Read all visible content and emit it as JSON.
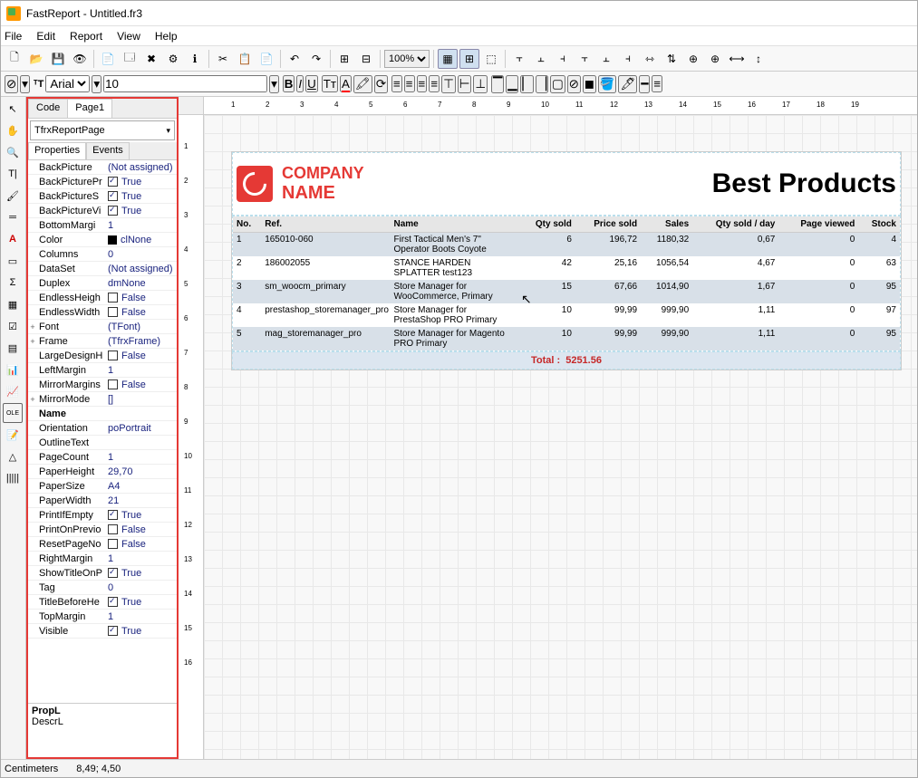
{
  "window": {
    "title": "FastReport - Untitled.fr3"
  },
  "menu": [
    "File",
    "Edit",
    "Report",
    "View",
    "Help"
  ],
  "toolbar": {
    "zoom": "100%",
    "font_label": "Arial",
    "font_size": "10"
  },
  "main_tabs": [
    "Code",
    "Page1"
  ],
  "combo": "TfrxReportPage",
  "sub_tabs": [
    "Properties",
    "Events"
  ],
  "props": [
    {
      "key": "BackPicture",
      "val": "(Not assigned)",
      "link": true
    },
    {
      "key": "BackPicturePrintable",
      "short": "BackPicturePr",
      "val": "True",
      "chk": true
    },
    {
      "key": "BackPictureStretched",
      "short": "BackPictureS",
      "val": "True",
      "chk": true
    },
    {
      "key": "BackPictureVisible",
      "short": "BackPictureVi",
      "val": "True",
      "chk": true
    },
    {
      "key": "BottomMargin",
      "short": "BottomMargi",
      "val": "1"
    },
    {
      "key": "Color",
      "val": "clNone",
      "swatch": true
    },
    {
      "key": "Columns",
      "val": "0"
    },
    {
      "key": "DataSet",
      "val": "(Not assigned)",
      "link": true
    },
    {
      "key": "Duplex",
      "val": "dmNone"
    },
    {
      "key": "EndlessHeight",
      "short": "EndlessHeigh",
      "val": "False",
      "chk": false
    },
    {
      "key": "EndlessWidth",
      "short": "EndlessWidth",
      "val": "False",
      "chk": false
    },
    {
      "key": "Font",
      "val": "(TFont)",
      "exp": "+",
      "link": true
    },
    {
      "key": "Frame",
      "val": "(TfrxFrame)",
      "exp": "+",
      "link": true
    },
    {
      "key": "LargeDesignHeight",
      "short": "LargeDesignH",
      "val": "False",
      "chk": false
    },
    {
      "key": "LeftMargin",
      "val": "1"
    },
    {
      "key": "MirrorMargins",
      "short": "MirrorMargins",
      "val": "False",
      "chk": false
    },
    {
      "key": "MirrorMode",
      "val": "[]",
      "exp": "+"
    },
    {
      "key": "Name",
      "val": "",
      "bold": true
    },
    {
      "key": "Orientation",
      "val": "poPortrait"
    },
    {
      "key": "OutlineText",
      "val": ""
    },
    {
      "key": "PageCount",
      "val": "1"
    },
    {
      "key": "PaperHeight",
      "val": "29,70"
    },
    {
      "key": "PaperSize",
      "val": "A4"
    },
    {
      "key": "PaperWidth",
      "val": "21"
    },
    {
      "key": "PrintIfEmpty",
      "val": "True",
      "chk": true
    },
    {
      "key": "PrintOnPreviousPage",
      "short": "PrintOnPrevio",
      "val": "False",
      "chk": false
    },
    {
      "key": "ResetPageNumbers",
      "short": "ResetPageNo",
      "val": "False",
      "chk": false
    },
    {
      "key": "RightMargin",
      "val": "1"
    },
    {
      "key": "ShowTitleOnPreviousPage",
      "short": "ShowTitleOnP",
      "val": "True",
      "chk": true
    },
    {
      "key": "Tag",
      "val": "0"
    },
    {
      "key": "TitleBeforeHeader",
      "short": "TitleBeforeHe",
      "val": "True",
      "chk": true
    },
    {
      "key": "TopMargin",
      "val": "1"
    },
    {
      "key": "Visible",
      "val": "True",
      "chk": true
    }
  ],
  "footer": {
    "prop": "PropL",
    "desc": "DescrL"
  },
  "ruler_h": [
    "1",
    "2",
    "3",
    "4",
    "5",
    "6",
    "7",
    "8",
    "9",
    "10",
    "11",
    "12",
    "13",
    "14",
    "15",
    "16",
    "17",
    "18",
    "19"
  ],
  "ruler_v": [
    "1",
    "2",
    "3",
    "4",
    "5",
    "6",
    "7",
    "8",
    "9",
    "10",
    "11",
    "12",
    "13",
    "14",
    "15",
    "16"
  ],
  "report": {
    "company_line1": "COMPANY",
    "company_line2": "NAME",
    "title": "Best Products",
    "columns": [
      "No.",
      "Ref.",
      "Name",
      "Qty sold",
      "Price sold",
      "Sales",
      "Qty sold / day",
      "Page viewed",
      "Stock"
    ],
    "rows": [
      {
        "no": "1",
        "ref": "165010-060",
        "name": "First Tactical Men's 7\" Operator Boots Coyote",
        "qty": "6",
        "price": "196,72",
        "sales": "1180,32",
        "qpd": "0,67",
        "pv": "0",
        "stock": "4"
      },
      {
        "no": "2",
        "ref": "186002055",
        "name": "STANCE HARDEN SPLATTER test123",
        "qty": "42",
        "price": "25,16",
        "sales": "1056,54",
        "qpd": "4,67",
        "pv": "0",
        "stock": "63"
      },
      {
        "no": "3",
        "ref": "sm_woocm_primary",
        "name": "Store Manager for WooCommerce, Primary",
        "qty": "15",
        "price": "67,66",
        "sales": "1014,90",
        "qpd": "1,67",
        "pv": "0",
        "stock": "95"
      },
      {
        "no": "4",
        "ref": "prestashop_storemanager_pro",
        "name": "Store Manager for PrestaShop PRO Primary",
        "qty": "10",
        "price": "99,99",
        "sales": "999,90",
        "qpd": "1,11",
        "pv": "0",
        "stock": "97"
      },
      {
        "no": "5",
        "ref": "mag_storemanager_pro",
        "name": "Store Manager for Magento PRO Primary",
        "qty": "10",
        "price": "99,99",
        "sales": "999,90",
        "qpd": "1,11",
        "pv": "0",
        "stock": "95"
      }
    ],
    "total_label": "Total :",
    "total_value": "5251.56"
  },
  "status": {
    "units": "Centimeters",
    "pos": "8,49; 4,50"
  },
  "chart_data": {
    "type": "table",
    "title": "Best Products",
    "columns": [
      "No.",
      "Ref.",
      "Name",
      "Qty sold",
      "Price sold",
      "Sales",
      "Qty sold / day",
      "Page viewed",
      "Stock"
    ],
    "rows": [
      [
        1,
        "165010-060",
        "First Tactical Men's 7\" Operator Boots Coyote",
        6,
        196.72,
        1180.32,
        0.67,
        0,
        4
      ],
      [
        2,
        "186002055",
        "STANCE HARDEN SPLATTER test123",
        42,
        25.16,
        1056.54,
        4.67,
        0,
        63
      ],
      [
        3,
        "sm_woocm_primary",
        "Store Manager for WooCommerce, Primary",
        15,
        67.66,
        1014.9,
        1.67,
        0,
        95
      ],
      [
        4,
        "prestashop_storemanager_pro",
        "Store Manager for PrestaShop PRO Primary",
        10,
        99.99,
        999.9,
        1.11,
        0,
        97
      ],
      [
        5,
        "mag_storemanager_pro",
        "Store Manager for Magento PRO Primary",
        10,
        99.99,
        999.9,
        1.11,
        0,
        95
      ]
    ],
    "total": 5251.56
  }
}
